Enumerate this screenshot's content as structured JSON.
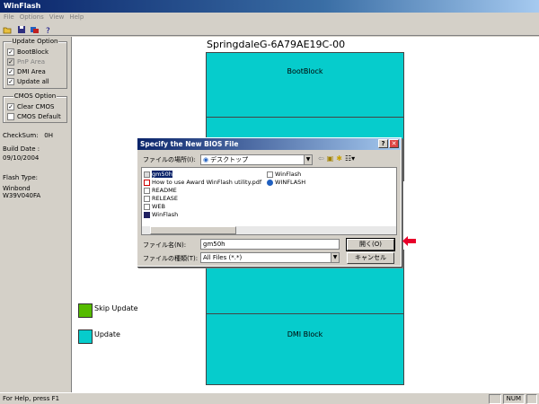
{
  "window": {
    "title": "WinFlash"
  },
  "menu": [
    "File",
    "Options",
    "View",
    "Help"
  ],
  "toolbar": {
    "icons": [
      "open-icon",
      "save-icon",
      "flash-icon",
      "help-icon"
    ]
  },
  "update_option": {
    "title": "Update Option",
    "items": [
      {
        "label": "BootBlock",
        "checked": true,
        "enabled": true
      },
      {
        "label": "PnP Area",
        "checked": true,
        "enabled": false
      },
      {
        "label": "DMI Area",
        "checked": true,
        "enabled": true
      },
      {
        "label": "Update all",
        "checked": true,
        "enabled": true
      }
    ]
  },
  "cmos_option": {
    "title": "CMOS Option",
    "items": [
      {
        "label": "Clear CMOS",
        "checked": true
      },
      {
        "label": "CMOS Default",
        "checked": false
      }
    ]
  },
  "info": {
    "checksum_label": "CheckSum:",
    "checksum_value": "0H",
    "build_date_label": "Build Date :",
    "build_date_value": "09/10/2004",
    "flash_type_label": "Flash Type:",
    "flash_type_value": "Winbond W39V040FA"
  },
  "bios": {
    "title": "SpringdaleG-6A79AE19C-00",
    "blocks": [
      {
        "label": "BootBlock"
      },
      {
        "label": ""
      },
      {
        "label": ""
      },
      {
        "label": "DMI Block"
      }
    ]
  },
  "legend": {
    "skip_label": "Skip Update",
    "skip_color": "#55bb00",
    "update_label": "Update",
    "update_color": "#06cccc"
  },
  "status": {
    "text": "For Help, press F1",
    "num": "NUM"
  },
  "dialog": {
    "title": "Specify the New BIOS File",
    "look_in_label": "ファイルの場所(I):",
    "look_in_value": "デスクトップ",
    "files": [
      {
        "name": "gm50h",
        "selected": true
      },
      {
        "name": "How to use Award WinFlash utility.pdf"
      },
      {
        "name": "README"
      },
      {
        "name": "RELEASE"
      },
      {
        "name": "WEB"
      },
      {
        "name": "WinFlash"
      },
      {
        "name": "WinFlash"
      },
      {
        "name": "WINFLASH"
      }
    ],
    "filename_label": "ファイル名(N):",
    "filename_value": "gm50h",
    "filetype_label": "ファイルの種類(T):",
    "filetype_value": "All Files (*.*)",
    "open_button": "開く(O)",
    "cancel_button": "キャンセル"
  },
  "colors": {
    "highlight_arrow": "#e8002a",
    "block": "#06cccc"
  }
}
